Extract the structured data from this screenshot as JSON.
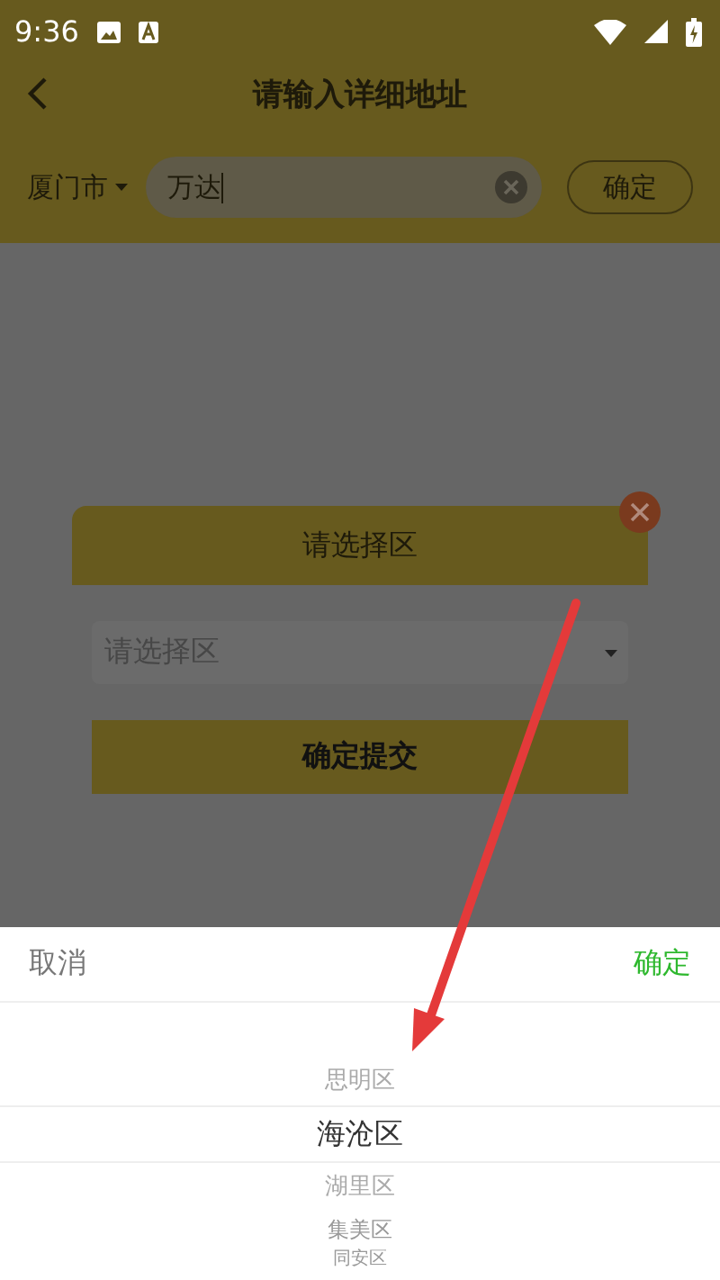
{
  "status_bar": {
    "time": "9:36"
  },
  "header": {
    "title": "请输入详细地址"
  },
  "search": {
    "city": "厦门市",
    "value": "万达",
    "button": "确定"
  },
  "dialog": {
    "title": "请选择区",
    "select": {
      "placeholder": "请选择区"
    },
    "submit": "确定提交"
  },
  "picker": {
    "cancel": "取消",
    "confirm": "确定",
    "options": [
      {
        "label": "思明区",
        "selected": false
      },
      {
        "label": "海沧区",
        "selected": true
      },
      {
        "label": "湖里区",
        "selected": false
      },
      {
        "label": "集美区",
        "selected": false
      },
      {
        "label": "同安区",
        "selected": false
      }
    ]
  }
}
